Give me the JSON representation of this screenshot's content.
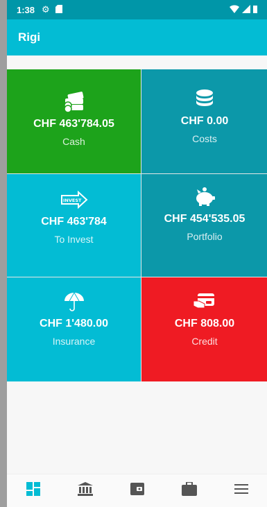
{
  "status_bar": {
    "time": "1:38"
  },
  "app_bar": {
    "title": "Rigi"
  },
  "tiles": [
    {
      "value": "CHF 463'784.05",
      "label": "Cash",
      "icon": "money-stack-icon",
      "color": "#1da31b"
    },
    {
      "value": "CHF 0.00",
      "label": "Costs",
      "icon": "coins-icon",
      "color": "#0c98a9"
    },
    {
      "value": "CHF 463'784",
      "label": "To Invest",
      "icon": "invest-arrow-icon",
      "icon_text": "INVEST",
      "color": "#03bcd4"
    },
    {
      "value": "CHF 454'535.05",
      "label": "Portfolio",
      "icon": "piggy-bank-icon",
      "color": "#0c98a9"
    },
    {
      "value": "CHF 1'480.00",
      "label": "Insurance",
      "icon": "umbrella-icon",
      "color": "#03bcd4"
    },
    {
      "value": "CHF 808.00",
      "label": "Credit",
      "icon": "credit-card-hand-icon",
      "color": "#ef1b23"
    }
  ],
  "bottom_nav": [
    {
      "icon": "dashboard-icon",
      "active": true,
      "color": "#03bcd4"
    },
    {
      "icon": "bank-icon"
    },
    {
      "icon": "wallet-icon"
    },
    {
      "icon": "briefcase-icon"
    },
    {
      "icon": "menu-icon"
    }
  ]
}
